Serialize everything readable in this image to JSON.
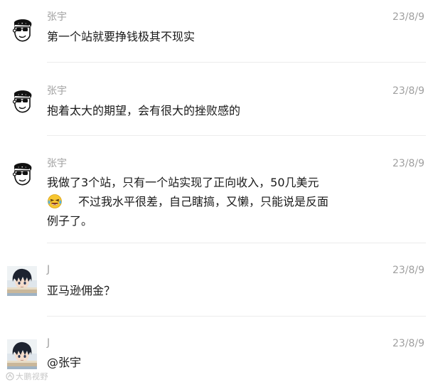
{
  "messages": [
    {
      "author": "张宇",
      "time": "23/8/9",
      "avatar_icon": "cartoon-face-sunglasses-icon",
      "lines": [
        "第一个站就要挣钱极其不现实"
      ]
    },
    {
      "author": "张宇",
      "time": "23/8/9",
      "avatar_icon": "cartoon-face-sunglasses-icon",
      "lines": [
        "抱着太大的期望，会有很大的挫败感的"
      ]
    },
    {
      "author": "张宇",
      "time": "23/8/9",
      "avatar_icon": "cartoon-face-sunglasses-icon",
      "lines": [
        "我做了3个站，只有一个站实现了正向收入，50几美元",
        "不过我水平很差，自己瞎搞，又懒，只能说是反面",
        "例子了。"
      ],
      "emoji_icon": "laughing-tears-emoji-icon"
    },
    {
      "author": "J",
      "time": "23/8/9",
      "avatar_icon": "anime-boy-photo-avatar",
      "lines": [
        "亚马逊佣金？"
      ]
    },
    {
      "author": "J",
      "time": "23/8/9",
      "avatar_icon": "anime-boy-photo-avatar",
      "lines": [
        "@张宇"
      ]
    }
  ],
  "watermark": {
    "text": "大鹏视野",
    "icon": "watermark-logo-icon"
  },
  "colors": {
    "meta_text": "#a0a0a0",
    "body_text": "#1a1a1a",
    "divider": "#ececec",
    "emoji_face": "#f7c631"
  }
}
